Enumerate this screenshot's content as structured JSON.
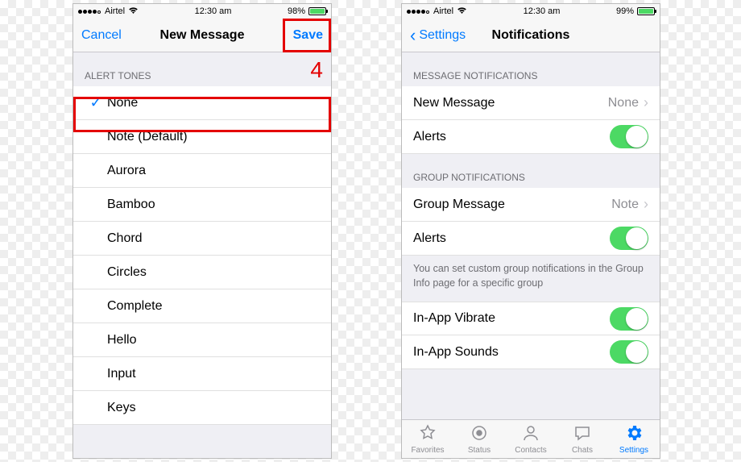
{
  "left": {
    "status": {
      "carrier": "Airtel",
      "time": "12:30 am",
      "battery_pct": "98%"
    },
    "nav": {
      "left": "Cancel",
      "title": "New Message",
      "right": "Save"
    },
    "step_label": "4",
    "tones_header": "ALERT TONES",
    "tones": [
      "None",
      "Note (Default)",
      "Aurora",
      "Bamboo",
      "Chord",
      "Circles",
      "Complete",
      "Hello",
      "Input",
      "Keys"
    ],
    "selected_index": 0
  },
  "right": {
    "status": {
      "carrier": "Airtel",
      "time": "12:30 am",
      "battery_pct": "99%"
    },
    "nav": {
      "back": "Settings",
      "title": "Notifications"
    },
    "sections": {
      "msg_header": "MESSAGE NOTIFICATIONS",
      "new_message_label": "New Message",
      "new_message_value": "None",
      "alerts_label": "Alerts",
      "grp_header": "GROUP NOTIFICATIONS",
      "group_message_label": "Group Message",
      "group_message_value": "Note",
      "group_alerts_label": "Alerts",
      "group_footer": "You can set custom group notifications in the Group Info page for a specific group",
      "in_app_vibrate": "In-App Vibrate",
      "in_app_sounds": "In-App Sounds"
    },
    "tabs": [
      "Favorites",
      "Status",
      "Contacts",
      "Chats",
      "Settings"
    ],
    "tab_active": 4
  }
}
